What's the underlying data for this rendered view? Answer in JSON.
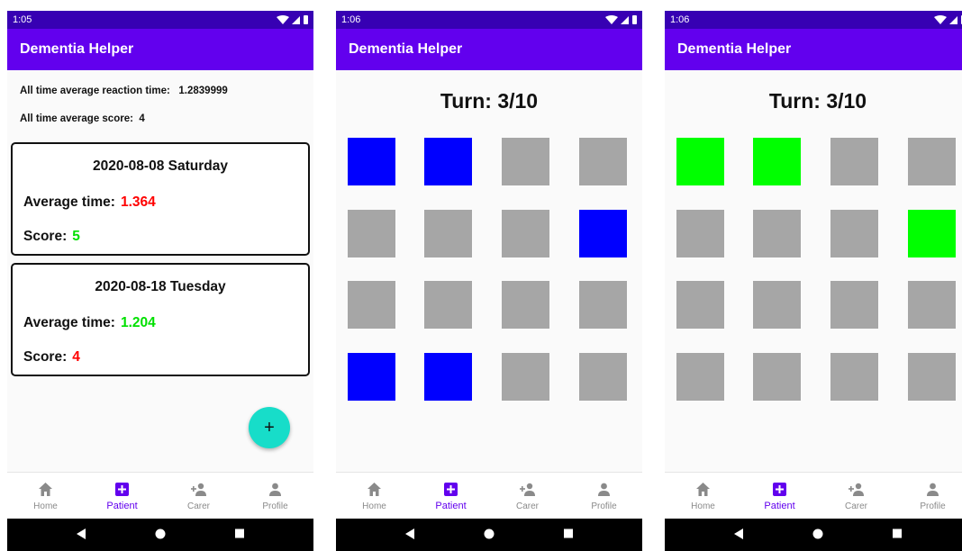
{
  "screens": [
    {
      "status_time": "1:05",
      "app_title": "Dementia Helper",
      "summary": {
        "reaction_label": "All time average reaction time:",
        "reaction_value": "1.2839999",
        "score_label": "All time average score:",
        "score_value": "4"
      },
      "sessions": [
        {
          "date": "2020-08-08 Saturday",
          "time_label": "Average time:",
          "time_value": "1.364",
          "time_color": "#ff0000",
          "score_label": "Score:",
          "score_value": "5",
          "score_color": "#00e000"
        },
        {
          "date": "2020-08-18 Tuesday",
          "time_label": "Average time:",
          "time_value": "1.204",
          "time_color": "#00e000",
          "score_label": "Score:",
          "score_value": "4",
          "score_color": "#ff0000"
        }
      ],
      "fab_label": "+",
      "fab_icon": "plus-icon"
    },
    {
      "status_time": "1:06",
      "app_title": "Dementia Helper",
      "turn_text": "Turn: 3/10",
      "grid_colors": [
        [
          "blue",
          "blue",
          "gray",
          "gray"
        ],
        [
          "gray",
          "gray",
          "gray",
          "blue"
        ],
        [
          "gray",
          "gray",
          "gray",
          "gray"
        ],
        [
          "blue",
          "blue",
          "gray",
          "gray"
        ]
      ]
    },
    {
      "status_time": "1:06",
      "app_title": "Dementia Helper",
      "turn_text": "Turn: 3/10",
      "grid_colors": [
        [
          "green",
          "green",
          "gray",
          "gray"
        ],
        [
          "gray",
          "gray",
          "gray",
          "green"
        ],
        [
          "gray",
          "gray",
          "gray",
          "gray"
        ],
        [
          "gray",
          "gray",
          "gray",
          "gray"
        ]
      ]
    }
  ],
  "tile_colors": {
    "blue": "#0000ff",
    "gray": "#a6a6a6",
    "green": "#00ff00"
  },
  "bottom_nav": [
    {
      "label": "Home",
      "icon": "home-icon"
    },
    {
      "label": "Patient",
      "icon": "patient-plus-icon",
      "active": true
    },
    {
      "label": "Carer",
      "icon": "add-person-icon"
    },
    {
      "label": "Profile",
      "icon": "person-icon"
    }
  ],
  "system_nav": [
    "back-icon",
    "home-circle-icon",
    "recents-icon"
  ],
  "colors": {
    "status_bar": "#3700b3",
    "app_bar": "#6200ee",
    "accent": "#6200ee",
    "fab": "#17ddc9"
  }
}
